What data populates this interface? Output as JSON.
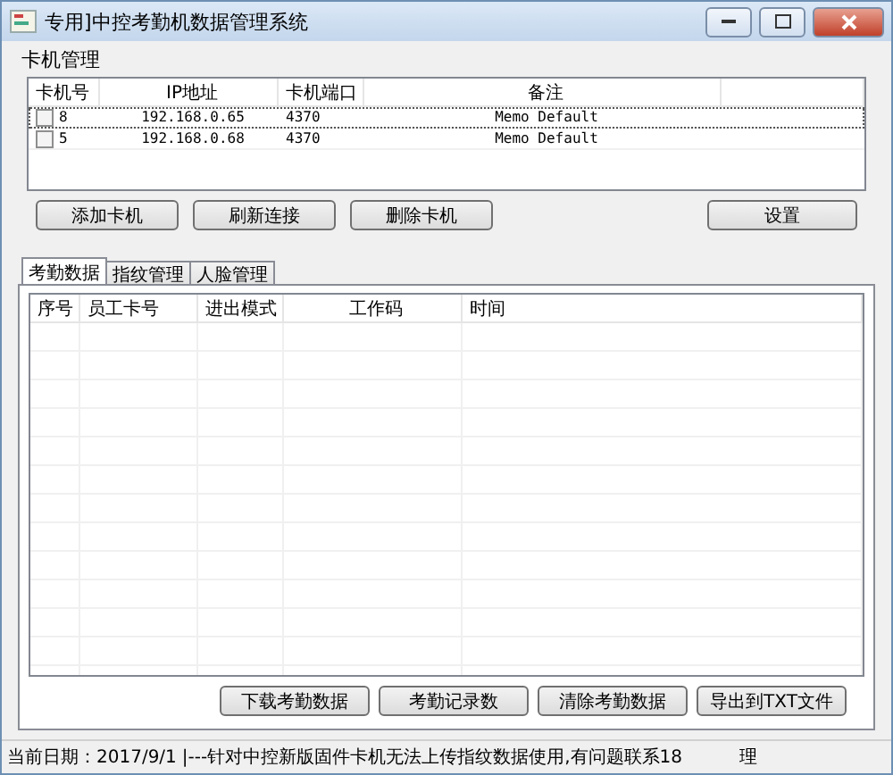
{
  "window": {
    "title": "专用]中控考勤机数据管理系统"
  },
  "device_group": {
    "title": "卡机管理",
    "columns": [
      "卡机号",
      "IP地址",
      "卡机端口",
      "备注"
    ],
    "rows": [
      {
        "number": "8",
        "ip": "192.168.0.65",
        "port": "4370",
        "memo": "Memo Default",
        "checked": false,
        "selected": true
      },
      {
        "number": "5",
        "ip": "192.168.0.68",
        "port": "4370",
        "memo": "Memo Default",
        "checked": false,
        "selected": false
      }
    ],
    "buttons": [
      "添加卡机",
      "刷新连接",
      "删除卡机"
    ],
    "settings_button": "设置"
  },
  "tabs": [
    {
      "label": "考勤数据",
      "selected": true
    },
    {
      "label": "指纹管理",
      "selected": false
    },
    {
      "label": "人脸管理",
      "selected": false
    }
  ],
  "records": {
    "columns": [
      "序号",
      "员工卡号",
      "进出模式",
      "工作码",
      "时间"
    ]
  },
  "actions": [
    "下载考勤数据",
    "考勤记录数",
    "清除考勤数据",
    "导出到TXT文件"
  ],
  "status_bar": {
    "date": "当前日期：2017/9/1",
    "message": "|---针对中控新版固件卡机无法上传指纹数据使用,有问题联系18",
    "message_end": "理"
  }
}
